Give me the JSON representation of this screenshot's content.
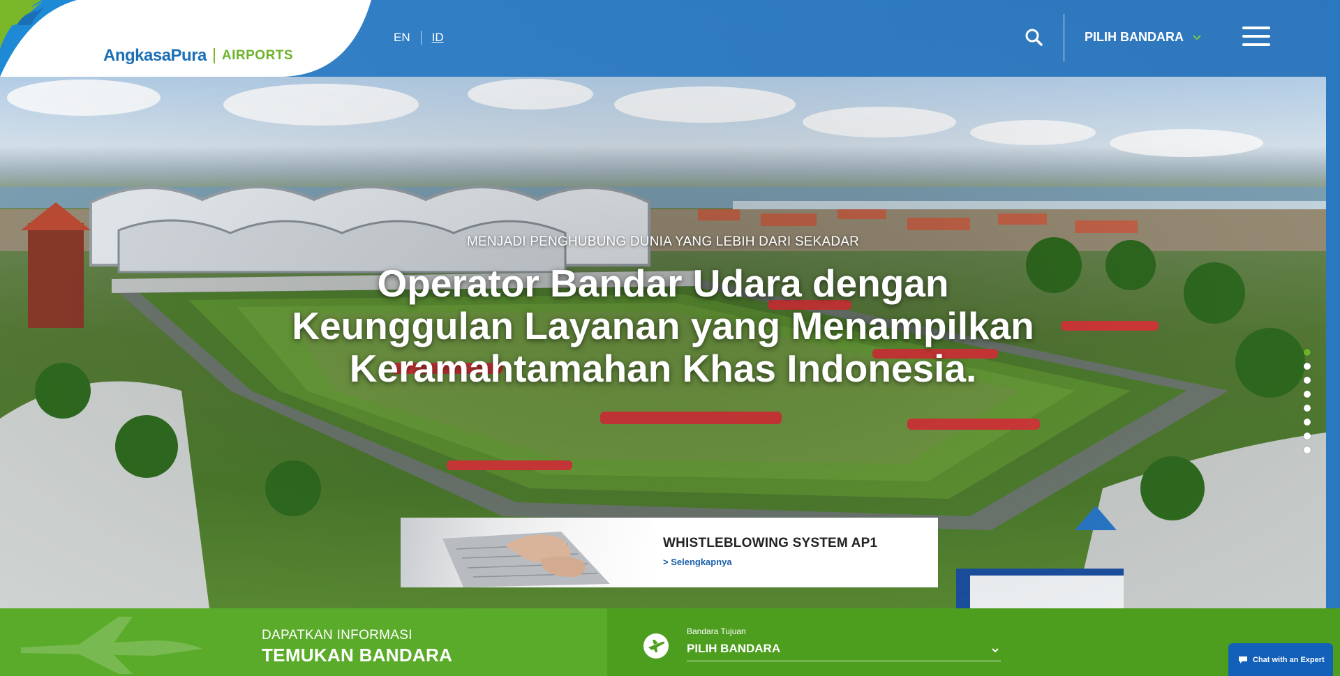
{
  "header": {
    "logo": {
      "brand": "AngkasaPura",
      "sub": "AIRPORTS"
    },
    "languages": [
      {
        "code": "EN",
        "active": false
      },
      {
        "code": "ID",
        "active": true
      }
    ],
    "airport_select_label": "PILIH BANDARA",
    "icons": {
      "search": "search-icon",
      "menu": "hamburger-menu-icon",
      "chevron": "chevron-down-icon"
    }
  },
  "hero": {
    "kicker": "MENJADI PENGHUBUNG DUNIA YANG LEBIH DARI SEKADAR",
    "title": "Operator Bandar Udara dengan Keunggulan Layanan yang Menampilkan Keramahtamahan Khas Indonesia.",
    "slides": 8,
    "active_slide": 1
  },
  "promo": {
    "title": "WHISTLEBLOWING SYSTEM AP1",
    "link": "> Selengkapnya"
  },
  "finder": {
    "kicker": "DAPATKAN INFORMASI",
    "title": "TEMUKAN BANDARA",
    "dest_label": "Bandara Tujuan",
    "dest_value": "PILIH BANDARA",
    "icon": "airplane-icon"
  },
  "chat": {
    "label": "Chat with an Expert",
    "icon": "chat-bubble-icon"
  },
  "colors": {
    "primary_blue": "#2b78bf",
    "green": "#5aab2a",
    "green_dark": "#4d9e1f",
    "chat_blue": "#1360b8"
  }
}
